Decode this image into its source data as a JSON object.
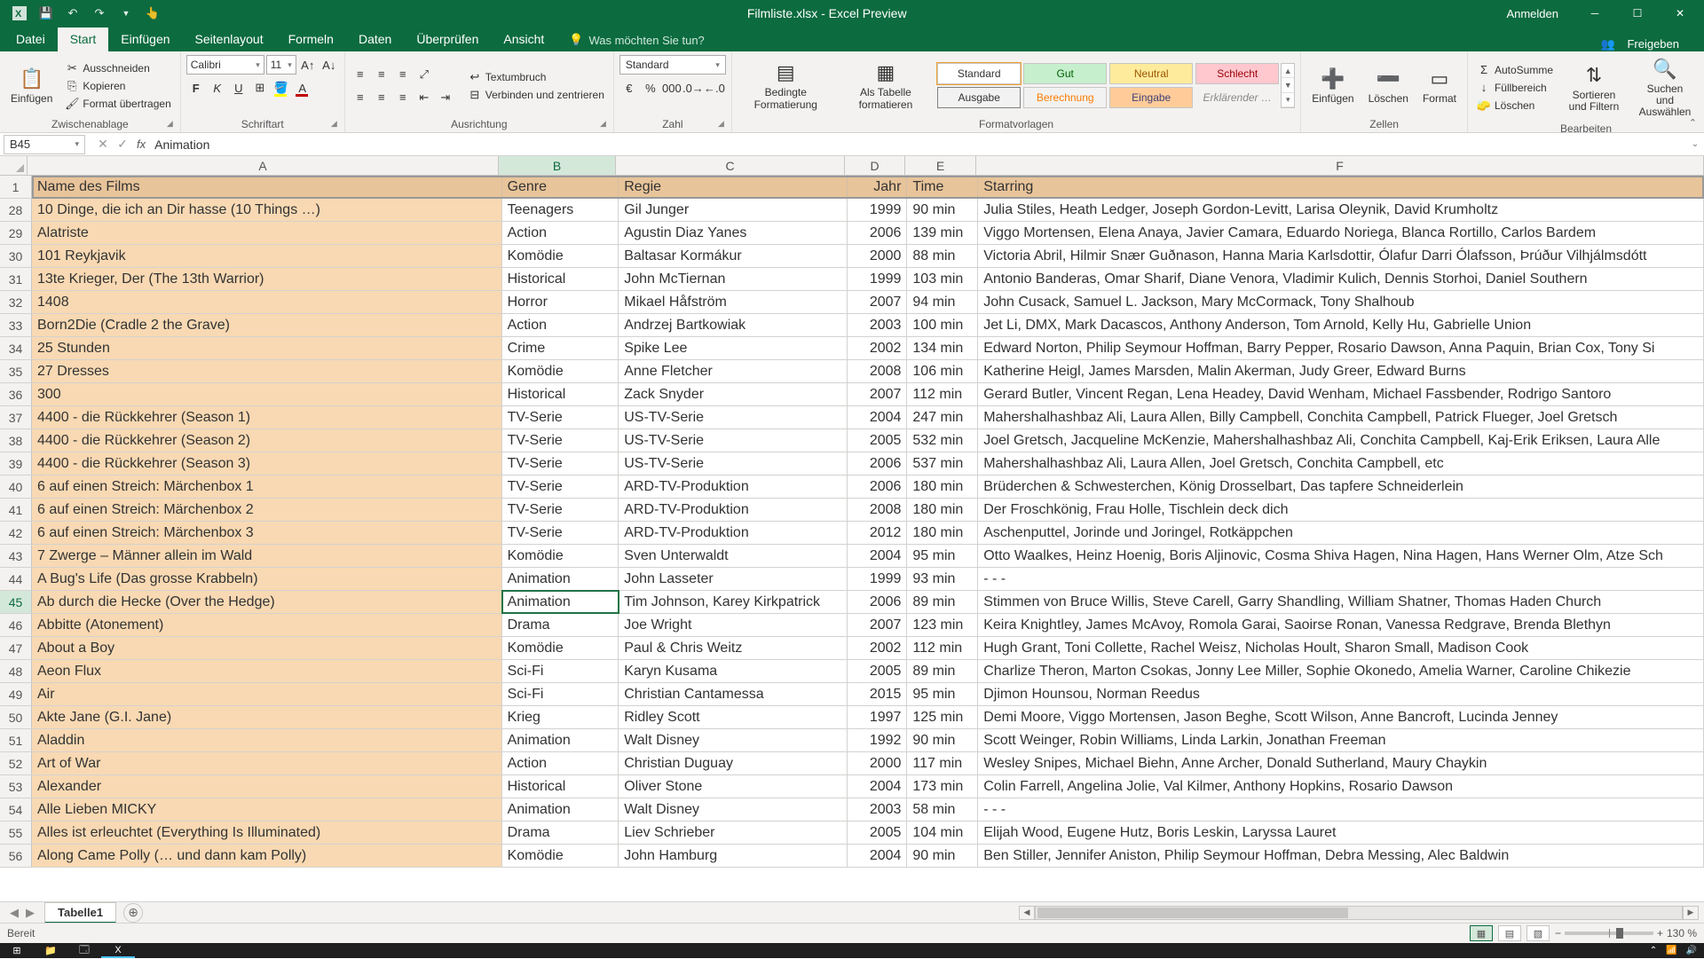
{
  "titlebar": {
    "title": "Filmliste.xlsx - Excel Preview",
    "login": "Anmelden"
  },
  "menu": {
    "file": "Datei",
    "home": "Start",
    "insert": "Einfügen",
    "layout": "Seitenlayout",
    "formulas": "Formeln",
    "data": "Daten",
    "review": "Überprüfen",
    "view": "Ansicht",
    "tell": "Was möchten Sie tun?",
    "share": "Freigeben"
  },
  "ribbon": {
    "clipboard": {
      "paste": "Einfügen",
      "cut": "Ausschneiden",
      "copy": "Kopieren",
      "format_painter": "Format übertragen",
      "label": "Zwischenablage"
    },
    "font": {
      "name": "Calibri",
      "size": "11",
      "label": "Schriftart"
    },
    "align": {
      "wrap": "Textumbruch",
      "merge": "Verbinden und zentrieren",
      "label": "Ausrichtung"
    },
    "number": {
      "format": "Standard",
      "label": "Zahl"
    },
    "styles": {
      "cond": "Bedingte Formatierung",
      "table": "Als Tabelle formatieren",
      "standard": "Standard",
      "good": "Gut",
      "neutral": "Neutral",
      "bad": "Schlecht",
      "output": "Ausgabe",
      "calc": "Berechnung",
      "input": "Eingabe",
      "explain": "Erklärender …",
      "label": "Formatvorlagen"
    },
    "cells": {
      "insert": "Einfügen",
      "delete": "Löschen",
      "format": "Format",
      "label": "Zellen"
    },
    "editing": {
      "autosum": "AutoSumme",
      "fill": "Füllbereich",
      "clear": "Löschen",
      "sort": "Sortieren und Filtern",
      "find": "Suchen und Auswählen",
      "label": "Bearbeiten"
    }
  },
  "formula": {
    "name": "B45",
    "value": "Animation"
  },
  "columns": [
    "A",
    "B",
    "C",
    "D",
    "E",
    "F"
  ],
  "header_row": {
    "n": 1,
    "cells": [
      "Name des Films",
      "Genre",
      "Regie",
      "Jahr",
      "Time",
      "Starring"
    ]
  },
  "rows": [
    {
      "n": 28,
      "c": [
        "10 Dinge, die ich an Dir hasse (10 Things …)",
        "Teenagers",
        "Gil Junger",
        "1999",
        "90 min",
        "Julia Stiles, Heath Ledger, Joseph Gordon-Levitt, Larisa Oleynik, David Krumholtz"
      ]
    },
    {
      "n": 29,
      "c": [
        "Alatriste",
        "Action",
        "Agustin Diaz Yanes",
        "2006",
        "139 min",
        "Viggo Mortensen, Elena Anaya, Javier Camara, Eduardo Noriega, Blanca Rortillo, Carlos Bardem"
      ]
    },
    {
      "n": 30,
      "c": [
        "101 Reykjavik",
        "Komödie",
        "Baltasar Kormákur",
        "2000",
        "88 min",
        "Victoria Abril, Hilmir Snær Guðnason, Hanna Maria Karlsdottir, Ólafur Darri Ólafsson, Þrúður Vilhjálmsdótt"
      ]
    },
    {
      "n": 31,
      "c": [
        "13te Krieger, Der (The 13th Warrior)",
        "Historical",
        "John McTiernan",
        "1999",
        "103 min",
        "Antonio Banderas, Omar Sharif, Diane Venora, Vladimir Kulich, Dennis Storhoi, Daniel Southern"
      ]
    },
    {
      "n": 32,
      "c": [
        "1408",
        "Horror",
        "Mikael Håfström",
        "2007",
        "94 min",
        "John Cusack, Samuel L. Jackson, Mary McCormack, Tony Shalhoub"
      ]
    },
    {
      "n": 33,
      "c": [
        "Born2Die (Cradle 2 the Grave)",
        "Action",
        "Andrzej Bartkowiak",
        "2003",
        "100 min",
        "Jet Li, DMX, Mark Dacascos, Anthony Anderson, Tom Arnold, Kelly Hu, Gabrielle Union"
      ]
    },
    {
      "n": 34,
      "c": [
        "25 Stunden",
        "Crime",
        "Spike Lee",
        "2002",
        "134 min",
        "Edward Norton, Philip Seymour Hoffman, Barry Pepper, Rosario Dawson, Anna Paquin, Brian Cox, Tony Si"
      ]
    },
    {
      "n": 35,
      "c": [
        "27 Dresses",
        "Komödie",
        "Anne Fletcher",
        "2008",
        "106 min",
        "Katherine Heigl, James Marsden, Malin Akerman, Judy Greer, Edward Burns"
      ]
    },
    {
      "n": 36,
      "c": [
        "300",
        "Historical",
        "Zack Snyder",
        "2007",
        "112 min",
        "Gerard Butler, Vincent Regan, Lena Headey, David Wenham, Michael Fassbender, Rodrigo Santoro"
      ]
    },
    {
      "n": 37,
      "c": [
        "4400 - die Rückkehrer (Season 1)",
        "TV-Serie",
        "US-TV-Serie",
        "2004",
        "247 min",
        "Mahershalhashbaz Ali, Laura Allen, Billy Campbell, Conchita Campbell, Patrick Flueger, Joel Gretsch"
      ]
    },
    {
      "n": 38,
      "c": [
        "4400 - die Rückkehrer (Season 2)",
        "TV-Serie",
        "US-TV-Serie",
        "2005",
        "532 min",
        "Joel Gretsch, Jacqueline McKenzie, Mahershalhashbaz Ali, Conchita Campbell, Kaj-Erik Eriksen, Laura Alle"
      ]
    },
    {
      "n": 39,
      "c": [
        "4400 - die Rückkehrer (Season 3)",
        "TV-Serie",
        "US-TV-Serie",
        "2006",
        "537 min",
        "Mahershalhashbaz Ali, Laura Allen, Joel Gretsch, Conchita Campbell, etc"
      ]
    },
    {
      "n": 40,
      "c": [
        "6 auf einen Streich: Märchenbox 1",
        "TV-Serie",
        "ARD-TV-Produktion",
        "2006",
        "180 min",
        "Brüderchen & Schwesterchen, König Drosselbart, Das tapfere Schneiderlein"
      ]
    },
    {
      "n": 41,
      "c": [
        "6 auf einen Streich: Märchenbox 2",
        "TV-Serie",
        "ARD-TV-Produktion",
        "2008",
        "180 min",
        "Der Froschkönig, Frau Holle, Tischlein deck dich"
      ]
    },
    {
      "n": 42,
      "c": [
        "6 auf einen Streich: Märchenbox 3",
        "TV-Serie",
        "ARD-TV-Produktion",
        "2012",
        "180 min",
        "Aschenputtel, Jorinde und Joringel, Rotkäppchen"
      ]
    },
    {
      "n": 43,
      "c": [
        "7 Zwerge – Männer allein im Wald",
        "Komödie",
        "Sven Unterwaldt",
        "2004",
        "95 min",
        "Otto Waalkes, Heinz Hoenig, Boris Aljinovic, Cosma Shiva Hagen, Nina Hagen, Hans Werner Olm, Atze Sch"
      ]
    },
    {
      "n": 44,
      "c": [
        "A Bug's Life (Das grosse Krabbeln)",
        "Animation",
        "John Lasseter",
        "1999",
        "93 min",
        "- - -"
      ]
    },
    {
      "n": 45,
      "c": [
        "Ab durch die Hecke (Over the Hedge)",
        "Animation",
        "Tim Johnson, Karey Kirkpatrick",
        "2006",
        "89 min",
        "Stimmen von Bruce Willis, Steve Carell, Garry Shandling, William Shatner, Thomas Haden Church"
      ]
    },
    {
      "n": 46,
      "c": [
        "Abbitte (Atonement)",
        "Drama",
        "Joe Wright",
        "2007",
        "123 min",
        "Keira Knightley, James McAvoy, Romola Garai, Saoirse Ronan, Vanessa Redgrave, Brenda Blethyn"
      ]
    },
    {
      "n": 47,
      "c": [
        "About a Boy",
        "Komödie",
        "Paul & Chris Weitz",
        "2002",
        "112 min",
        "Hugh Grant, Toni Collette, Rachel Weisz, Nicholas Hoult, Sharon Small, Madison Cook"
      ]
    },
    {
      "n": 48,
      "c": [
        "Aeon Flux",
        "Sci-Fi",
        "Karyn Kusama",
        "2005",
        "89 min",
        "Charlize Theron, Marton Csokas, Jonny Lee Miller, Sophie Okonedo, Amelia Warner, Caroline Chikezie"
      ]
    },
    {
      "n": 49,
      "c": [
        "Air",
        "Sci-Fi",
        "Christian Cantamessa",
        "2015",
        "95 min",
        "Djimon Hounsou, Norman Reedus"
      ]
    },
    {
      "n": 50,
      "c": [
        "Akte Jane (G.I. Jane)",
        "Krieg",
        "Ridley Scott",
        "1997",
        "125 min",
        "Demi Moore, Viggo Mortensen, Jason Beghe, Scott Wilson, Anne Bancroft, Lucinda Jenney"
      ]
    },
    {
      "n": 51,
      "c": [
        "Aladdin",
        "Animation",
        "Walt Disney",
        "1992",
        "90 min",
        "Scott Weinger, Robin Williams, Linda Larkin, Jonathan Freeman"
      ]
    },
    {
      "n": 52,
      "c": [
        "Art of War",
        "Action",
        "Christian Duguay",
        "2000",
        "117 min",
        "Wesley Snipes, Michael Biehn, Anne Archer, Donald Sutherland, Maury Chaykin"
      ]
    },
    {
      "n": 53,
      "c": [
        "Alexander",
        "Historical",
        "Oliver Stone",
        "2004",
        "173 min",
        "Colin Farrell, Angelina Jolie, Val Kilmer, Anthony Hopkins, Rosario Dawson"
      ]
    },
    {
      "n": 54,
      "c": [
        "Alle Lieben MICKY",
        "Animation",
        "Walt Disney",
        "2003",
        "58 min",
        "- - -"
      ]
    },
    {
      "n": 55,
      "c": [
        "Alles ist erleuchtet (Everything Is Illuminated)",
        "Drama",
        "Liev Schrieber",
        "2005",
        "104 min",
        "Elijah Wood, Eugene Hutz, Boris Leskin, Laryssa Lauret"
      ]
    },
    {
      "n": 56,
      "c": [
        "Along Came Polly (… und dann kam Polly)",
        "Komödie",
        "John Hamburg",
        "2004",
        "90 min",
        "Ben Stiller, Jennifer Aniston, Philip Seymour Hoffman, Debra Messing, Alec Baldwin"
      ]
    }
  ],
  "selected": {
    "row": 45,
    "col": "B"
  },
  "sheet": {
    "name": "Tabelle1"
  },
  "status": {
    "ready": "Bereit",
    "zoom": "130 %"
  }
}
